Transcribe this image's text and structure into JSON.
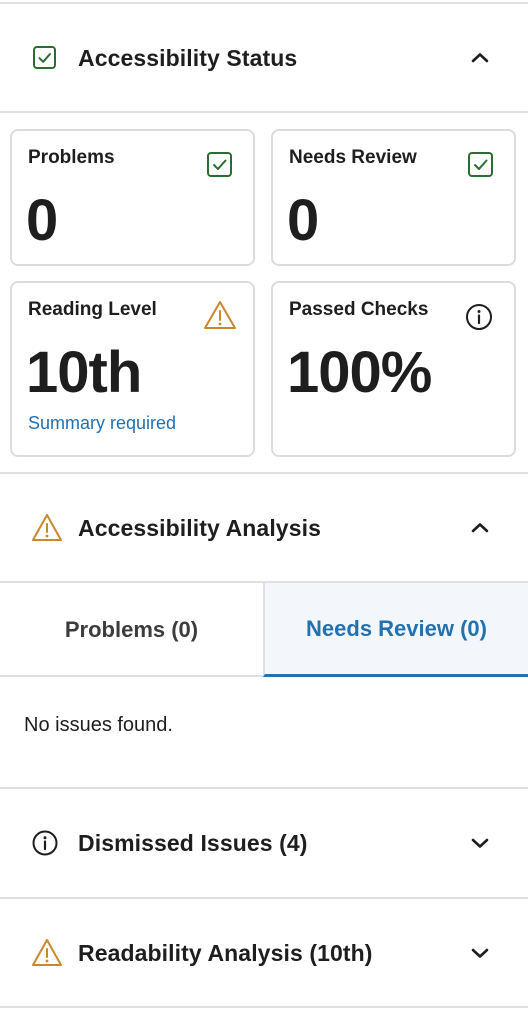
{
  "status_section": {
    "title": "Accessibility Status",
    "icon": "check-box-icon",
    "expanded": true,
    "colors": {
      "check": "#2a6e2f",
      "warning": "#c9882a",
      "info": "#1e1e1e",
      "link": "#2271b1"
    }
  },
  "cards": {
    "problems": {
      "label": "Problems",
      "value": "0",
      "icon": "check-box-icon"
    },
    "needs_review": {
      "label": "Needs Review",
      "value": "0",
      "icon": "check-box-icon"
    },
    "reading_level": {
      "label": "Reading Level",
      "value": "10th",
      "note": "Summary required",
      "icon": "warning-icon"
    },
    "passed_checks": {
      "label": "Passed Checks",
      "value": "100%",
      "icon": "info-icon"
    }
  },
  "analysis_section": {
    "title": "Accessibility Analysis",
    "icon": "warning-icon",
    "expanded": true,
    "tabs": [
      {
        "label": "Problems  (0)",
        "active": false
      },
      {
        "label": "Needs Review  (0)",
        "active": true
      }
    ],
    "empty_message": "No issues found."
  },
  "dismissed_section": {
    "title": "Dismissed Issues (4)",
    "icon": "info-icon",
    "expanded": false
  },
  "readability_section": {
    "title": "Readability Analysis (10th)",
    "icon": "warning-icon",
    "expanded": false
  }
}
